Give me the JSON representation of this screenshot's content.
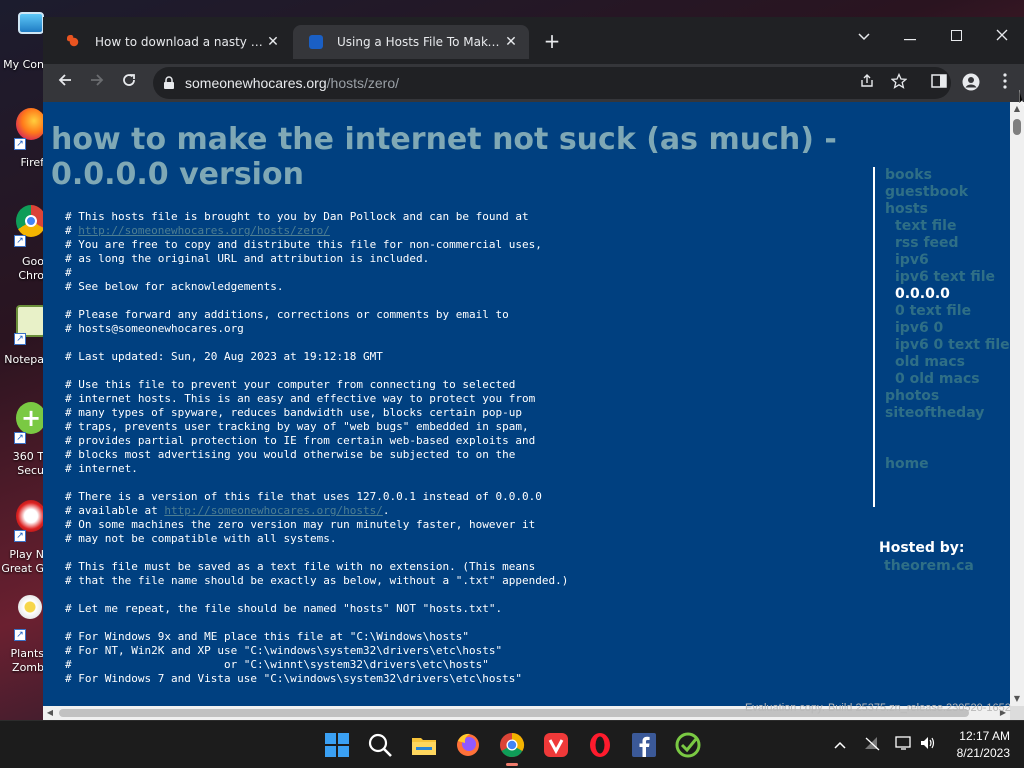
{
  "desktop": {
    "icons": [
      {
        "label": "My Con",
        "name": "my-computer"
      },
      {
        "label": "Firef",
        "name": "firefox"
      },
      {
        "label": "Goo",
        "label2": "Chro",
        "name": "google-chrome"
      },
      {
        "label": "Notepa",
        "name": "notepad"
      },
      {
        "label": "360 T",
        "label2": "Secu",
        "name": "360-total-security"
      },
      {
        "label": "Play N",
        "label2": "Great G",
        "name": "play-great-games"
      },
      {
        "label": "Plants",
        "label2": "Zomb",
        "name": "plants-vs-zombies"
      }
    ]
  },
  "browser": {
    "tabs": [
      {
        "title": "How to download a nasty virus...",
        "favicon": "ubuntu-style-orange",
        "active": false
      },
      {
        "title": "Using a Hosts File To Make The In",
        "favicon": "blue-square",
        "active": true
      }
    ],
    "newtab_glyph": "+",
    "window_controls": {
      "dropdown": "⌄",
      "minimize": "—",
      "maximize": "☐",
      "close": "✕"
    },
    "url_host": "someonewhocares.org",
    "url_path": "/hosts/zero/"
  },
  "page": {
    "title": "how to make the internet not suck (as much) - 0.0.0.0 version",
    "lines": [
      {
        "text": "# This hosts file is brought to you by Dan Pollock and can be found at"
      },
      {
        "prefix": "# ",
        "link": "http://someonewhocares.org/hosts/zero/",
        "suffix": ""
      },
      {
        "text": "# You are free to copy and distribute this file for non-commercial uses,"
      },
      {
        "text": "# as long the original URL and attribution is included."
      },
      {
        "text": "#"
      },
      {
        "text": "# See below for acknowledgements."
      },
      {
        "text": ""
      },
      {
        "text": "# Please forward any additions, corrections or comments by email to"
      },
      {
        "text": "# hosts@someonewhocares.org"
      },
      {
        "text": ""
      },
      {
        "text": "# Last updated: Sun, 20 Aug 2023 at 19:12:18 GMT"
      },
      {
        "text": ""
      },
      {
        "text": "# Use this file to prevent your computer from connecting to selected"
      },
      {
        "text": "# internet hosts. This is an easy and effective way to protect you from"
      },
      {
        "text": "# many types of spyware, reduces bandwidth use, blocks certain pop-up"
      },
      {
        "text": "# traps, prevents user tracking by way of \"web bugs\" embedded in spam,"
      },
      {
        "text": "# provides partial protection to IE from certain web-based exploits and"
      },
      {
        "text": "# blocks most advertising you would otherwise be subjected to on the"
      },
      {
        "text": "# internet."
      },
      {
        "text": ""
      },
      {
        "text": "# There is a version of this file that uses 127.0.0.1 instead of 0.0.0.0"
      },
      {
        "prefix": "# available at ",
        "link": "http://someonewhocares.org/hosts/",
        "suffix": "."
      },
      {
        "text": "# On some machines the zero version may run minutely faster, however it"
      },
      {
        "text": "# may not be compatible with all systems."
      },
      {
        "text": ""
      },
      {
        "text": "# This file must be saved as a text file with no extension. (This means"
      },
      {
        "text": "# that the file name should be exactly as below, without a \".txt\" appended.)"
      },
      {
        "text": ""
      },
      {
        "text": "# Let me repeat, the file should be named \"hosts\" NOT \"hosts.txt\"."
      },
      {
        "text": ""
      },
      {
        "text": "# For Windows 9x and ME place this file at \"C:\\Windows\\hosts\""
      },
      {
        "text": "# For NT, Win2K and XP use \"C:\\windows\\system32\\drivers\\etc\\hosts\""
      },
      {
        "text": "#                       or \"C:\\winnt\\system32\\drivers\\etc\\hosts\""
      },
      {
        "text": "# For Windows 7 and Vista use \"C:\\windows\\system32\\drivers\\etc\\hosts\""
      }
    ],
    "sidebar": [
      {
        "label": "books",
        "sub": false,
        "current": false
      },
      {
        "label": "guestbook",
        "sub": false,
        "current": false
      },
      {
        "label": "hosts",
        "sub": false,
        "current": false
      },
      {
        "label": "text file",
        "sub": true,
        "current": false
      },
      {
        "label": "rss feed",
        "sub": true,
        "current": false
      },
      {
        "label": "ipv6",
        "sub": true,
        "current": false
      },
      {
        "label": "ipv6 text file",
        "sub": true,
        "current": false
      },
      {
        "label": "0.0.0.0",
        "sub": true,
        "current": true
      },
      {
        "label": "0 text file",
        "sub": true,
        "current": false
      },
      {
        "label": "ipv6 0",
        "sub": true,
        "current": false
      },
      {
        "label": "ipv6 0 text file",
        "sub": true,
        "current": false
      },
      {
        "label": "old macs",
        "sub": true,
        "current": false
      },
      {
        "label": "0 old macs",
        "sub": true,
        "current": false
      },
      {
        "label": "photos",
        "sub": false,
        "current": false
      },
      {
        "label": "siteoftheday",
        "sub": false,
        "current": false
      },
      {
        "label": "home",
        "sub": false,
        "current": false,
        "gap": true
      }
    ],
    "hosted_by_label": "Hosted by:",
    "hosted_by_link": "theorem.ca"
  },
  "watermark": "Evaluation copy. Build 25375.zn_release.230520-1652",
  "taskbar": {
    "apps": [
      "windows-start",
      "search",
      "file-explorer",
      "firefox",
      "chrome",
      "vivaldi",
      "opera",
      "facebook",
      "unknown-green-app"
    ],
    "active_app": "chrome",
    "tray": [
      "chevron-up",
      "network-disconnected",
      "display",
      "volume"
    ],
    "time": "12:17 AM",
    "date": "8/21/2023"
  },
  "colors": {
    "page_bg": "#004080",
    "title": "#7fa8b5",
    "link": "#2f6f86",
    "browser_frame": "#202124",
    "toolbar": "#35363a"
  }
}
